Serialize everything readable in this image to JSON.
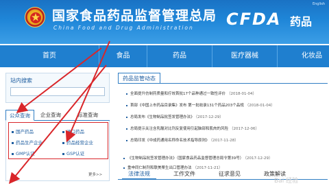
{
  "header": {
    "title": "国家食品药品监督管理总局",
    "subtitle": "China Food and Drug Administration",
    "brand": "CFDA",
    "brand_section": "药品",
    "english_link": "English"
  },
  "nav": {
    "items": [
      "首页",
      "食品",
      "药品",
      "医疗器械",
      "化妆品"
    ]
  },
  "sidebar": {
    "search_title": "站内搜索",
    "search_placeholder": "",
    "tabs": [
      "公众查询",
      "企业查询",
      "标准查询"
    ],
    "active_tab": "公众查询",
    "query_links": [
      "国产药品",
      "进口药品",
      "药品生产企业",
      "药品经营企业",
      "GMP认证",
      "GSP认证"
    ],
    "more": "更多>>"
  },
  "main": {
    "section_title": "药品监管动态",
    "news": [
      {
        "title": "全面提升仿制药质量和疗效首批17个品种通过一致性评价",
        "date": "（2018-01-04）"
      },
      {
        "title": "首部《中国上市药品目录集》发布 第一批收录131个药品203个品规",
        "date": "（2018-01-04）"
      },
      {
        "title": "总局发布《生物制品批签发管理办法》",
        "date": "（2017-12-29）"
      },
      {
        "title": "总局提示关注含乳酸对比剂反复使用引起脑部和肌肉的风险",
        "date": "（2017-12-06）"
      },
      {
        "title": "总局印发《中成药通用名称命名技术指导原则》",
        "date": "（2017-11-28）"
      }
    ],
    "sub_tabs": [
      "法律法规",
      "工作文件",
      "征求意见",
      "政策解读"
    ],
    "active_sub_tab": "法律法规",
    "law_items": [
      {
        "title": "《生物制品批签发管理办法》（国家食品药品监督管理总局令第39号）",
        "date": "（2017-12-29）"
      },
      {
        "title": "重申同仁制剂和联美栗生出口管理办法",
        "date": "（2017-11-21）"
      }
    ]
  },
  "watermark": "Bai 经验",
  "colors": {
    "header_blue": "#1f86d8",
    "nav_blue": "#1f7fcf",
    "link_blue": "#1f5ea0",
    "annotation_red": "#d9262a"
  }
}
